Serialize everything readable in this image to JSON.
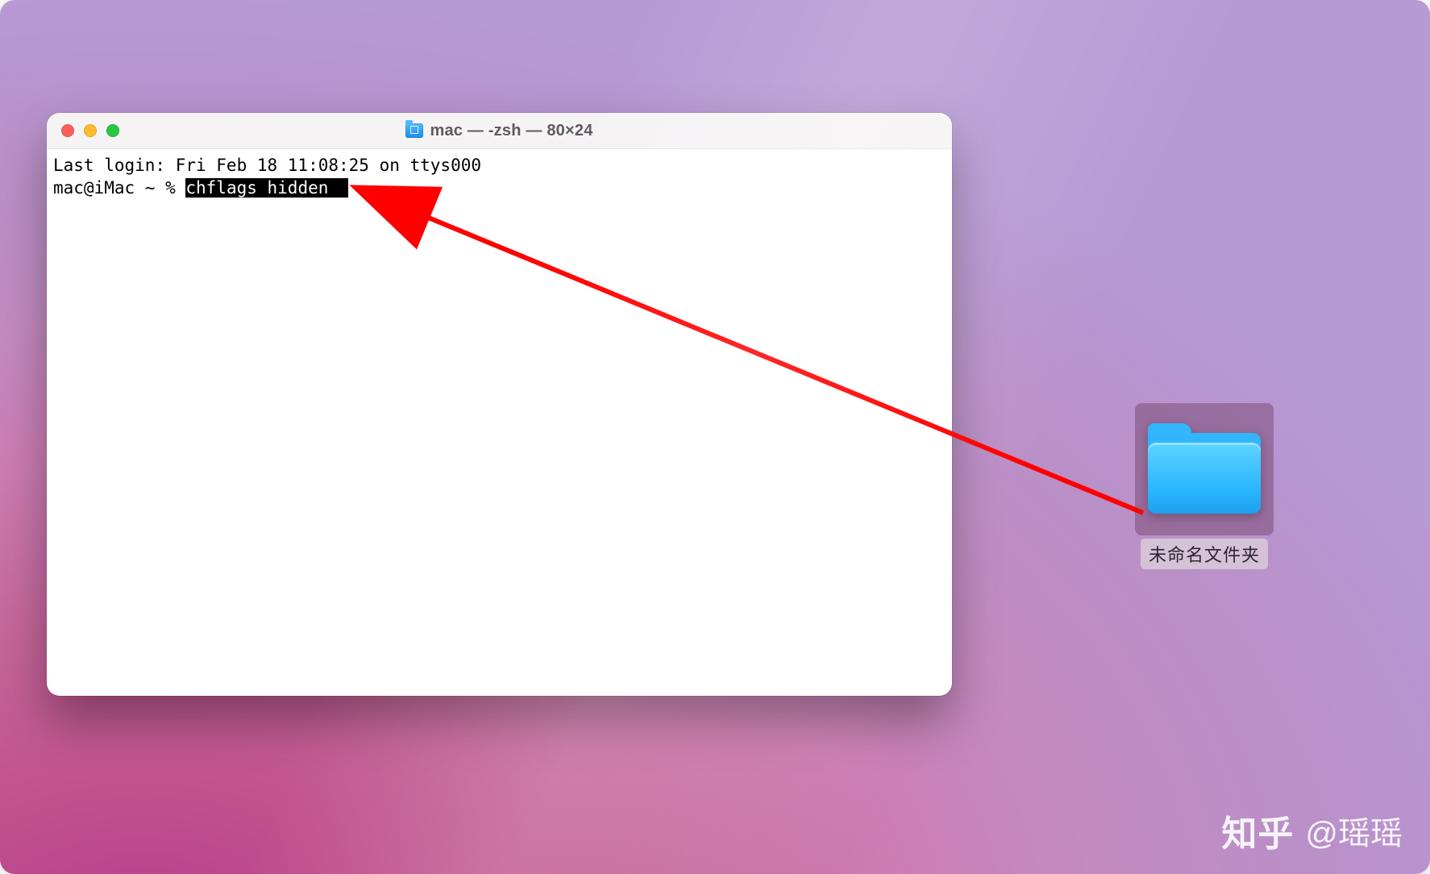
{
  "terminal": {
    "window_title": "mac — -zsh — 80×24",
    "last_login_line": "Last login: Fri Feb 18 11:08:25 on ttys000",
    "prompt": "mac@iMac ~ % ",
    "command_selected": "chflags hidden "
  },
  "desktop": {
    "folder_label": "未命名文件夹"
  },
  "watermark": {
    "logo": "知乎",
    "author": "@瑶瑶"
  },
  "colors": {
    "arrow": "#ff0000"
  }
}
